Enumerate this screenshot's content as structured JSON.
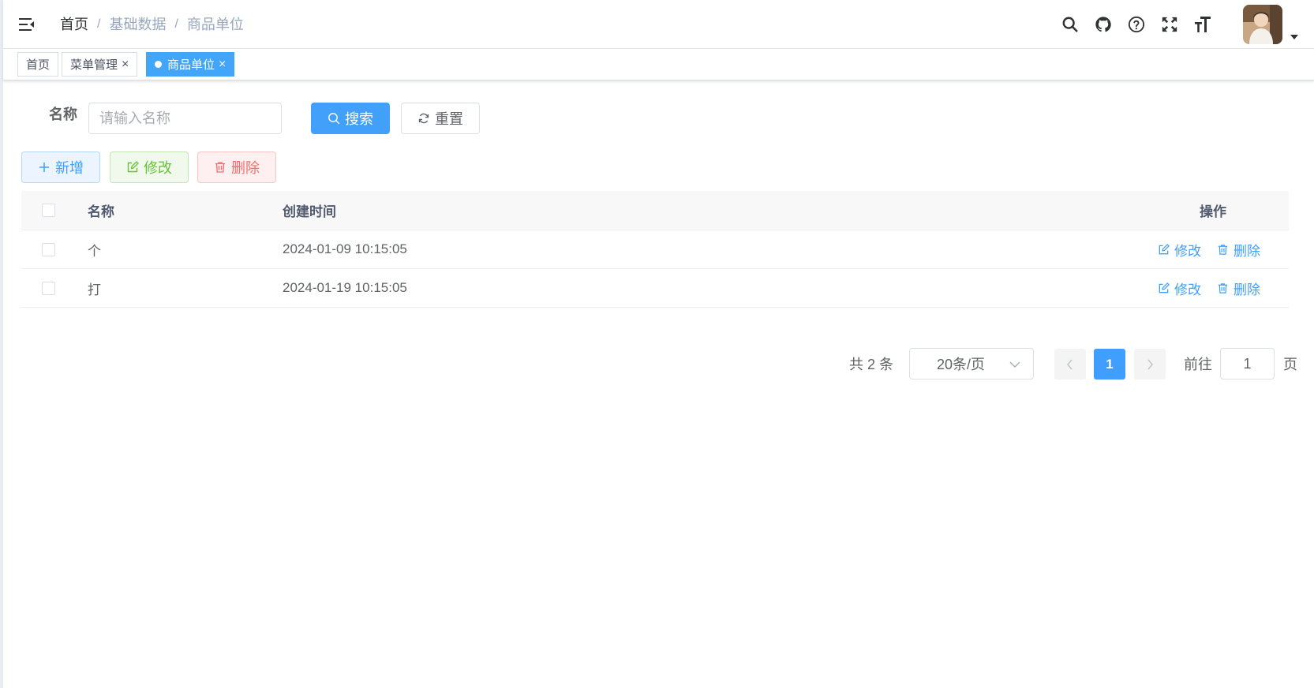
{
  "breadcrumb": [
    "首页",
    "基础数据",
    "商品单位"
  ],
  "breadcrumb_separator": "/",
  "header_icons": [
    "search-icon",
    "github-icon",
    "help-icon",
    "fullscreen-icon",
    "font-size-icon"
  ],
  "tags": [
    {
      "label": "首页",
      "closable": false,
      "active": false
    },
    {
      "label": "菜单管理",
      "closable": true,
      "active": false
    },
    {
      "label": "商品单位",
      "closable": true,
      "active": true
    }
  ],
  "tag_close": "×",
  "search": {
    "label": "名称",
    "placeholder": "请输入名称",
    "search_label": "搜索",
    "reset_label": "重置"
  },
  "toolbar": {
    "add_label": "新增",
    "edit_label": "修改",
    "delete_label": "删除"
  },
  "table": {
    "columns": [
      "名称",
      "创建时间",
      "操作"
    ],
    "rows": [
      {
        "name": "个",
        "created": "2024-01-09 10:15:05"
      },
      {
        "name": "打",
        "created": "2024-01-19 10:15:05"
      }
    ],
    "row_edit": "修改",
    "row_delete": "删除"
  },
  "pagination": {
    "total_text": "共 2 条",
    "page_size": "20条/页",
    "current_page": "1",
    "goto_label": "前往",
    "goto_value": "1",
    "page_suffix": "页"
  },
  "colors": {
    "primary": "#409eff",
    "success": "#67c23a",
    "danger": "#f56c6c",
    "active_tag": "#42a5f7"
  }
}
